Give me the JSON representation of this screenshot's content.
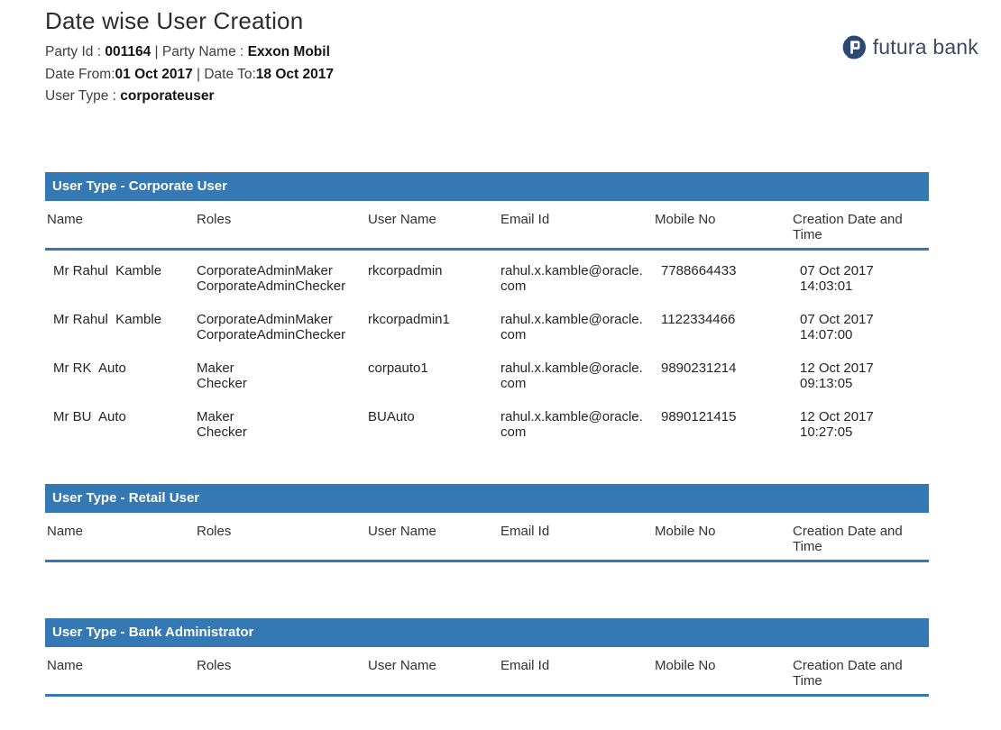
{
  "report": {
    "title": "Date wise User Creation",
    "party_id_label": "Party Id : ",
    "party_id": "001164",
    "separator": " | ",
    "party_name_label": "Party Name : ",
    "party_name": "Exxon Mobil",
    "date_from_label": "Date From:",
    "date_from": "01 Oct 2017",
    "date_to_label": "Date To:",
    "date_to": "18 Oct 2017",
    "user_type_label": "User Type : ",
    "user_type": "corporateuser"
  },
  "logo": {
    "text": "futura bank"
  },
  "colors": {
    "accent_blue": "#3478B4",
    "bar_text": "#FFFFFF",
    "logo_navy": "#2B4872"
  },
  "columns": [
    "Name",
    "Roles",
    "User Name",
    "Email Id",
    "Mobile No",
    "Creation Date and Time"
  ],
  "sections": [
    {
      "title": "User Type - Corporate User",
      "rows": [
        {
          "name": "Mr Rahul  Kamble",
          "roles": "CorporateAdminMaker\nCorporateAdminChecker",
          "user_name": "rkcorpadmin",
          "email": "rahul.x.kamble@oracle.com",
          "mobile": "7788664433",
          "creation": "07 Oct 2017\n14:03:01"
        },
        {
          "name": "Mr Rahul  Kamble",
          "roles": "CorporateAdminMaker\nCorporateAdminChecker",
          "user_name": "rkcorpadmin1",
          "email": "rahul.x.kamble@oracle.com",
          "mobile": "1122334466",
          "creation": "07 Oct 2017\n14:07:00"
        },
        {
          "name": "Mr RK  Auto",
          "roles": "Maker\nChecker",
          "user_name": "corpauto1",
          "email": "rahul.x.kamble@oracle.com",
          "mobile": "9890231214",
          "creation": "12 Oct 2017\n09:13:05"
        },
        {
          "name": "Mr BU  Auto",
          "roles": "Maker\nChecker",
          "user_name": "BUAuto",
          "email": "rahul.x.kamble@oracle.com",
          "mobile": "9890121415",
          "creation": "12 Oct 2017\n10:27:05"
        }
      ]
    },
    {
      "title": "User Type - Retail User",
      "rows": []
    },
    {
      "title": "User Type - Bank Administrator",
      "rows": []
    }
  ]
}
